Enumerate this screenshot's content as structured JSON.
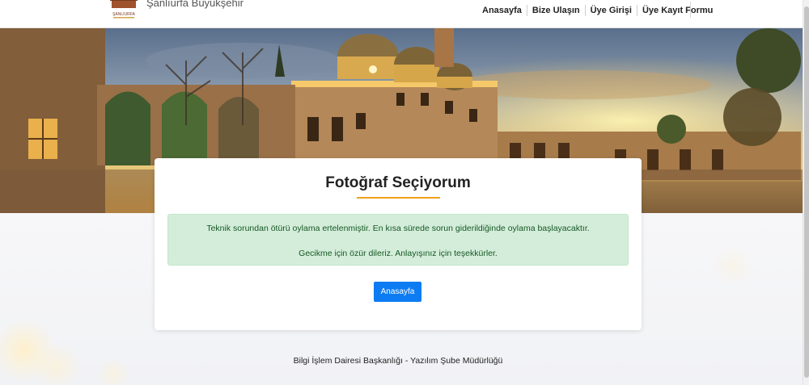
{
  "header": {
    "brand_text": "Şanlıurfa Büyükşehir",
    "logo_text": "ŞANLIURFA",
    "nav": [
      {
        "label": "Anasayfa"
      },
      {
        "label": "Bize Ulaşın"
      },
      {
        "label": "Üye Girişi"
      },
      {
        "label": "Üye Kayıt Formu"
      }
    ]
  },
  "card": {
    "title": "Fotoğraf Seçiyorum",
    "alert_line1": "Teknik sorundan ötürü oylama ertelenmiştir. En kısa sürede sorun giderildiğinde oylama başlayacaktır.",
    "alert_line2": "Gecikme için özür dileriz. Anlayışınız için teşekkürler.",
    "button_label": "Anasayfa"
  },
  "footer": {
    "text": "Bilgi İşlem Dairesi Başkanlığı - Yazılım Şube Müdürlüğü"
  },
  "colors": {
    "accent_underline": "#f0a11a",
    "button": "#0d7cf2",
    "alert_bg": "#d4edda",
    "alert_text": "#155724"
  }
}
